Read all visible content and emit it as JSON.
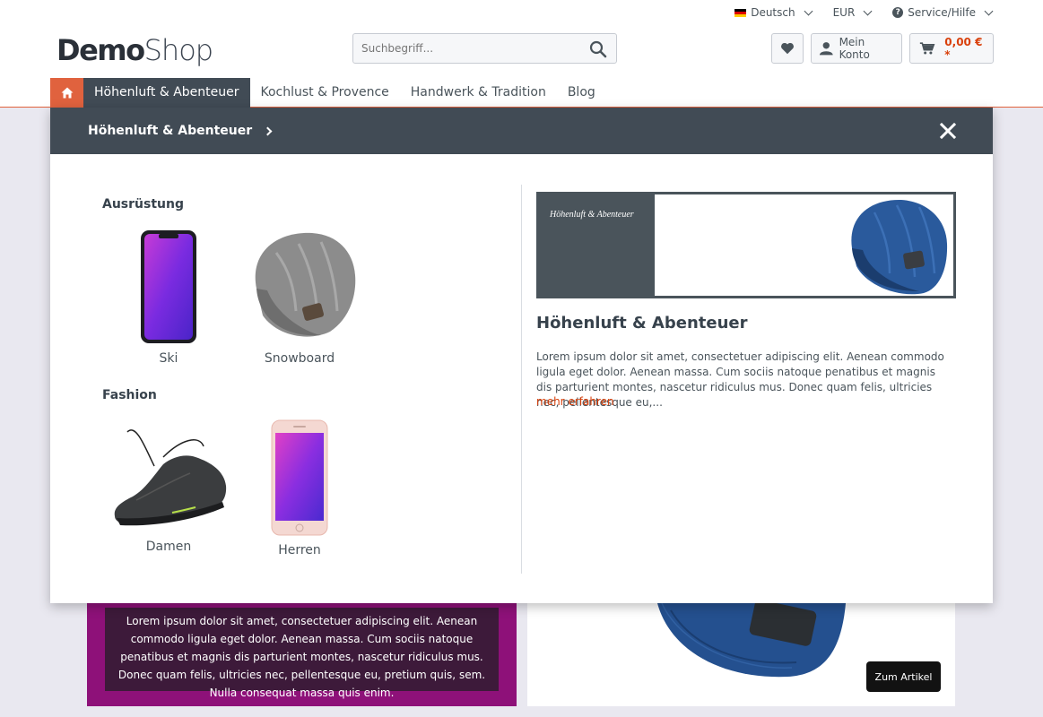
{
  "topbar": {
    "language": "Deutsch",
    "currency": "EUR",
    "service": "Service/Hilfe"
  },
  "logo": {
    "part1": "Demo",
    "part2": "Shop"
  },
  "search": {
    "placeholder": "Suchbegriff..."
  },
  "actions": {
    "account": "Mein Konto",
    "cart_price": "0,00 € *"
  },
  "nav": {
    "items": [
      {
        "label": "Höhenluft & Abenteuer"
      },
      {
        "label": "Kochlust & Provence"
      },
      {
        "label": "Handwerk & Tradition"
      },
      {
        "label": "Blog"
      }
    ]
  },
  "flyout": {
    "title": "Höhenluft & Abenteuer",
    "categories": [
      {
        "name": "Ausrüstung",
        "items": [
          {
            "label": "Ski"
          },
          {
            "label": "Snowboard"
          }
        ]
      },
      {
        "name": "Fashion",
        "items": [
          {
            "label": "Damen"
          },
          {
            "label": "Herren"
          }
        ]
      }
    ],
    "teaser_label": "Höhenluft & Abenteuer",
    "heading": "Höhenluft & Abenteuer",
    "description": "Lorem ipsum dolor sit amet, consectetuer adipiscing elit. Aenean commodo ligula eget dolor. Aenean massa. Cum sociis natoque penatibus et magnis dis parturient montes, nascetur ridiculus mus. Donec quam felis, ultricies nec, pellentesque eu,...",
    "more": "mehr erfahren"
  },
  "promo": {
    "text": "Lorem ipsum dolor sit amet, consectetuer adipiscing elit. Aenean commodo ligula eget dolor. Aenean massa. Cum sociis natoque penatibus et magnis dis parturient montes, nascetur ridiculus mus. Donec quam felis, ultricies nec, pellentesque eu, pretium quis, sem. Nulla consequat massa quis enim."
  },
  "product_card": {
    "button": "Zum Artikel"
  },
  "colors": {
    "accent": "#e0623e",
    "price": "#d9400b",
    "nav_dark": "#414b55",
    "promo": "#8e1179"
  },
  "icons": [
    "german-flag-icon",
    "chevron-down-icon",
    "question-icon",
    "search-icon",
    "heart-icon",
    "user-icon",
    "cart-icon",
    "home-icon",
    "chevron-right-icon",
    "close-icon"
  ]
}
